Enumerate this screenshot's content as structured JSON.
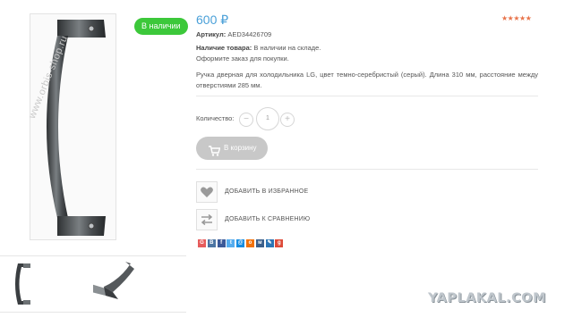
{
  "product": {
    "stock_badge": "В наличии",
    "watermark": "www.orbis-shop.ru",
    "price": "600",
    "currency_symbol": "₽",
    "rating_stars": "★★★★★",
    "article_label": "Артикул:",
    "article_value": "AED34426709",
    "availability_label": "Наличие товара:",
    "availability_value": "В наличии на складе.",
    "order_hint": "Оформите заказ для покупки.",
    "description": "Ручка дверная для холодильника LG, цвет темно-серебристый (серый). Длина 310 мм, расстояние между отверстиями 285 мм."
  },
  "quantity": {
    "label": "Количество:",
    "minus": "−",
    "value": "1",
    "plus": "+"
  },
  "cart_button": {
    "label": "В корзину"
  },
  "actions": {
    "favorites": "ДОБАВИТЬ В ИЗБРАННОЕ",
    "compare": "ДОБАВИТЬ К СРАВНЕНИЮ"
  },
  "share": {
    "buttons": [
      {
        "name": "share-icon-1",
        "color": "#e65c5c",
        "glyph": "G"
      },
      {
        "name": "vk-icon",
        "color": "#4c75a3",
        "glyph": "В"
      },
      {
        "name": "facebook-icon",
        "color": "#3b5998",
        "glyph": "f"
      },
      {
        "name": "twitter-icon",
        "color": "#55acee",
        "glyph": "t"
      },
      {
        "name": "mailru-icon",
        "color": "#168de2",
        "glyph": "@"
      },
      {
        "name": "odnoklassniki-icon",
        "color": "#f2720c",
        "glyph": "o"
      },
      {
        "name": "moikrug-icon",
        "color": "#3a5f8b",
        "glyph": "м"
      },
      {
        "name": "livejournal-icon",
        "color": "#2c75b5",
        "glyph": "✎"
      },
      {
        "name": "googleplus-icon",
        "color": "#dd4b39",
        "glyph": "g"
      }
    ]
  },
  "watermark_site": "YAPLAKAL.COM",
  "colors": {
    "accent": "#4aa0d8",
    "badge": "#3cc83a",
    "rating": "#e8734a",
    "cart_disabled": "#c8c8c8"
  }
}
